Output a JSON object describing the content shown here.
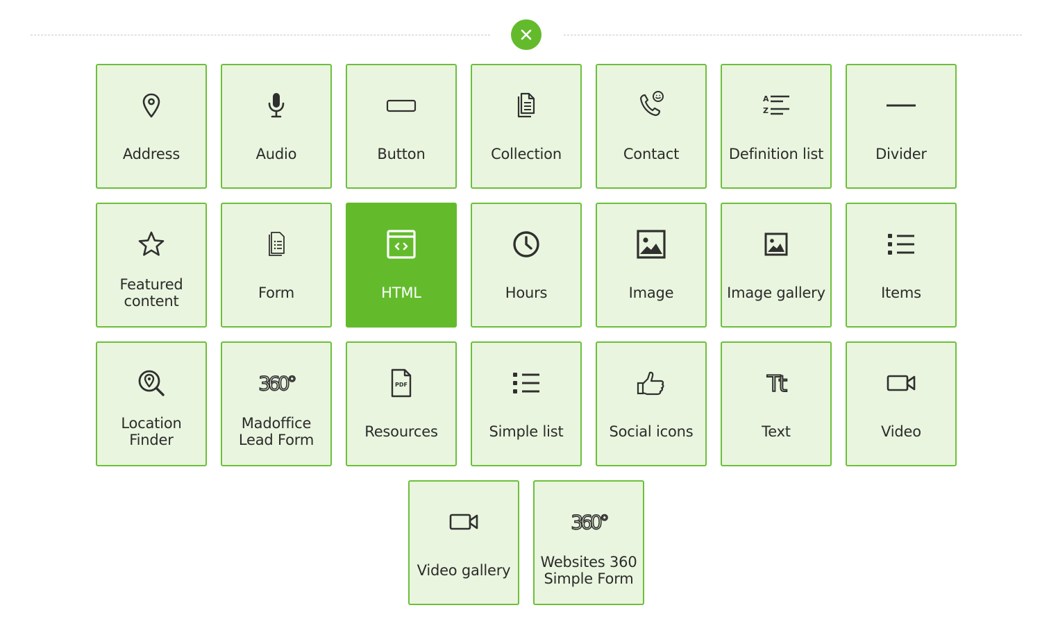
{
  "header": {
    "close_icon": "close-x-icon",
    "accent_color": "#63bb2c"
  },
  "tiles": [
    {
      "id": "address",
      "label": "Address",
      "icon": "map-pin-icon"
    },
    {
      "id": "audio",
      "label": "Audio",
      "icon": "microphone-icon"
    },
    {
      "id": "button",
      "label": "Button",
      "icon": "button-rect-icon"
    },
    {
      "id": "collection",
      "label": "Collection",
      "icon": "documents-icon"
    },
    {
      "id": "contact",
      "label": "Contact",
      "icon": "phone-chat-icon"
    },
    {
      "id": "definition-list",
      "label": "Definition list",
      "icon": "a-z-list-icon"
    },
    {
      "id": "divider",
      "label": "Divider",
      "icon": "horizontal-line-icon"
    },
    {
      "id": "featured-content",
      "label": "Featured\ncontent",
      "icon": "star-icon"
    },
    {
      "id": "form",
      "label": "Form",
      "icon": "form-document-icon"
    },
    {
      "id": "html",
      "label": "HTML",
      "icon": "code-window-icon",
      "active": true
    },
    {
      "id": "hours",
      "label": "Hours",
      "icon": "clock-icon"
    },
    {
      "id": "image",
      "label": "Image",
      "icon": "image-icon"
    },
    {
      "id": "image-gallery",
      "label": "Image gallery",
      "icon": "image-small-icon"
    },
    {
      "id": "items",
      "label": "Items",
      "icon": "bullet-list-icon"
    },
    {
      "id": "location-finder",
      "label": "Location\nFinder",
      "icon": "location-search-icon"
    },
    {
      "id": "madoffice-lead-form",
      "label": "Madoffice\nLead Form",
      "icon": "360-logo-icon",
      "icon_text": "360°"
    },
    {
      "id": "resources",
      "label": "Resources",
      "icon": "pdf-file-icon",
      "icon_text": "PDF"
    },
    {
      "id": "simple-list",
      "label": "Simple list",
      "icon": "bullet-list-icon"
    },
    {
      "id": "social-icons",
      "label": "Social icons",
      "icon": "thumbs-up-icon"
    },
    {
      "id": "text",
      "label": "Text",
      "icon": "text-tt-icon",
      "icon_text": "Tt"
    },
    {
      "id": "video",
      "label": "Video",
      "icon": "video-camera-icon"
    },
    {
      "id": "video-gallery",
      "label": "Video gallery",
      "icon": "video-camera-icon"
    },
    {
      "id": "websites-360-simple-form",
      "label": "Websites 360\nSimple Form",
      "icon": "360-logo-icon",
      "icon_text": "360°"
    }
  ]
}
